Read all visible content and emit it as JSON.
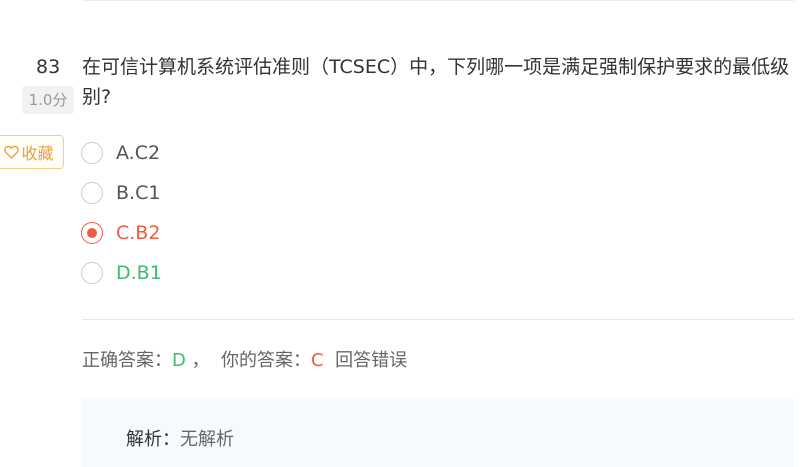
{
  "question": {
    "number": "83",
    "score": "1.0分",
    "text": "在可信计算机系统评估准则（TCSEC）中，下列哪一项是满足强制保护要求的最低级别?",
    "favorite_label": "收藏"
  },
  "options": [
    {
      "label": "A.C2",
      "state": "unselected"
    },
    {
      "label": "B.C1",
      "state": "unselected"
    },
    {
      "label": "C.B2",
      "state": "selected-wrong"
    },
    {
      "label": "D.B1",
      "state": "correct"
    }
  ],
  "result": {
    "correct_prefix": "正确答案：",
    "correct_value": "D",
    "separator": " ，  ",
    "yours_prefix": "你的答案：",
    "yours_value": "C",
    "status": "回答错误"
  },
  "analysis": {
    "label": "解析：",
    "value": "无解析"
  },
  "colors": {
    "wrong": "#f05b41",
    "correct": "#3fbb70",
    "favorite": "#e6a23c"
  }
}
